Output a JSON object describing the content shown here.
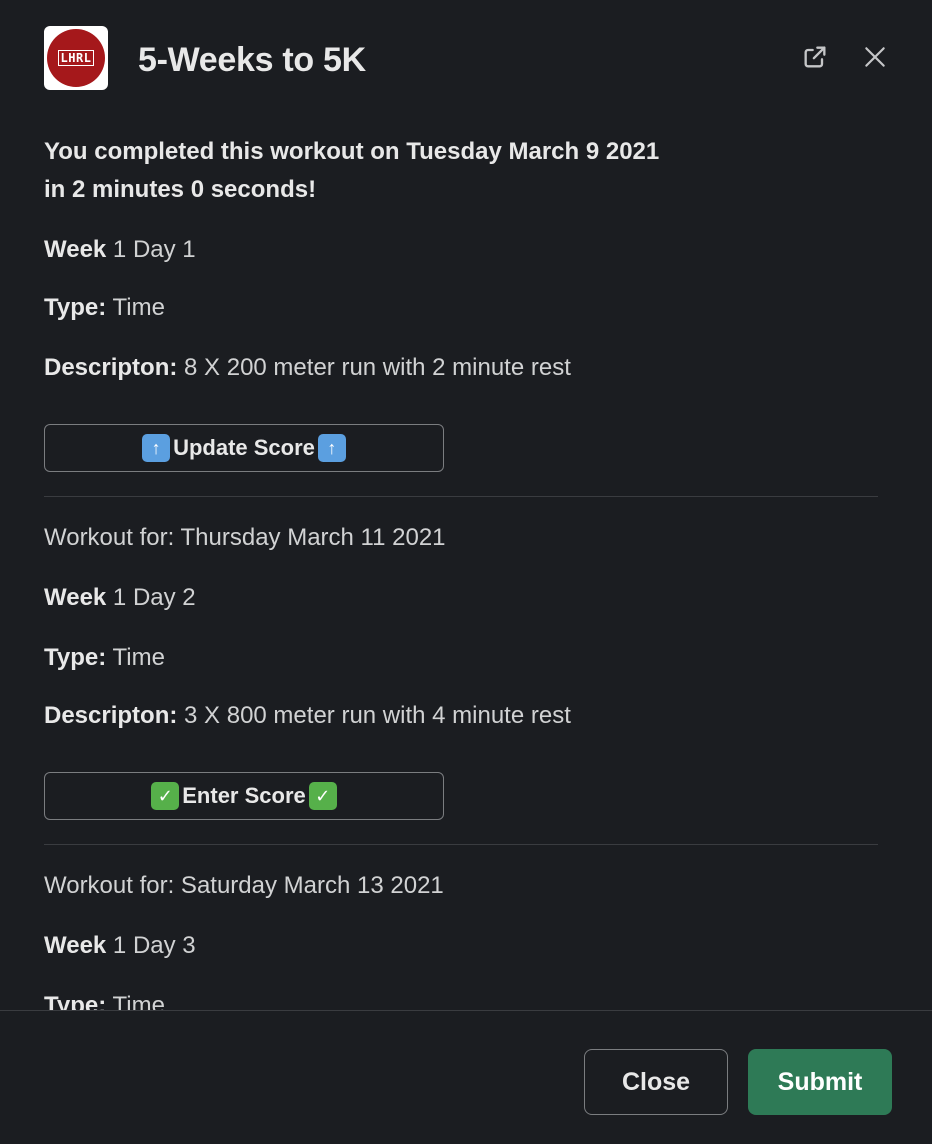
{
  "modal": {
    "title": "5-Weeks to 5K",
    "logo_text": "LHRL"
  },
  "completed": {
    "line1": "You completed this workout on Tuesday March 9 2021",
    "line2": "in 2 minutes 0 seconds!"
  },
  "workouts": [
    {
      "week_label": "Week",
      "week_value": " 1 Day 1",
      "type_label": "Type:",
      "type_value": " Time",
      "desc_label": "Descripton:",
      "desc_value": " 8 X 200 meter run with 2 minute rest",
      "button_label": "Update Score",
      "button_icon": "up-arrow-emoji-icon"
    },
    {
      "date_line": "Workout for: Thursday March 11 2021",
      "week_label": "Week",
      "week_value": " 1 Day 2",
      "type_label": "Type:",
      "type_value": " Time",
      "desc_label": "Descripton:",
      "desc_value": " 3 X 800 meter run with 4 minute rest",
      "button_label": "Enter Score",
      "button_icon": "check-mark-emoji-icon"
    },
    {
      "date_line": "Workout for: Saturday March 13 2021",
      "week_label": "Week",
      "week_value": " 1 Day 3",
      "type_label": "Type:",
      "type_value": " Time"
    }
  ],
  "footer": {
    "close_label": "Close",
    "submit_label": "Submit"
  },
  "colors": {
    "background": "#1b1d21",
    "submit": "#2e7a56",
    "logo_red": "#a5181b"
  }
}
